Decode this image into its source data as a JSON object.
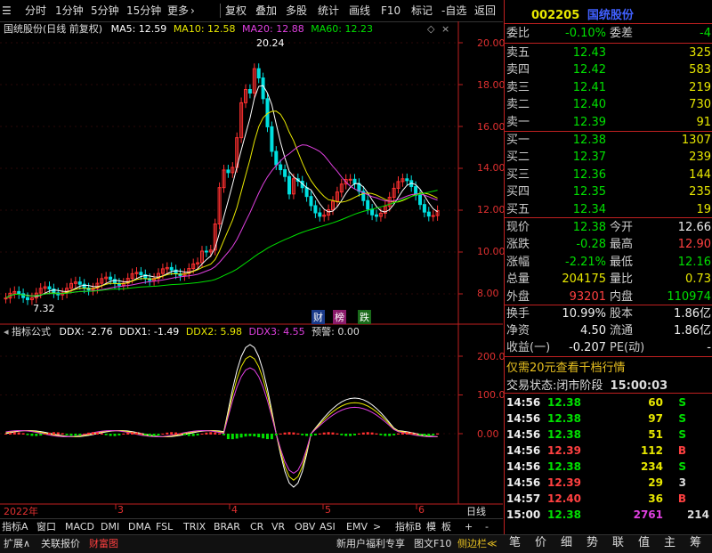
{
  "toolbar": {
    "items": [
      "分时",
      "1分钟",
      "5分钟",
      "15分钟",
      "更多",
      "复权",
      "叠加",
      "多股",
      "统计",
      "画线",
      "F10",
      "标记",
      "-自选",
      "返回"
    ]
  },
  "chart": {
    "stock_title": "国统股份(日线 前复权)",
    "ma5": "MA5: 12.59",
    "ma10": "MA10: 12.58",
    "ma20": "MA20: 12.88",
    "ma60": "MA60: 12.23",
    "high_label": "20.24",
    "low_label": "7.32",
    "y_labels": [
      "20.00",
      "18.00",
      "16.00",
      "14.00",
      "12.00",
      "10.00",
      "8.00"
    ],
    "tags": [
      "财",
      "榜",
      "跌"
    ],
    "colors": {
      "up": "#ff3030",
      "down": "#00e0e0",
      "ma5": "#ffffff",
      "ma10": "#e8e800",
      "ma20": "#e040e0",
      "ma60": "#00e000"
    }
  },
  "indicator": {
    "name": "指标公式",
    "ddx": "DDX: -2.76",
    "ddx1": "DDX1: -1.49",
    "ddx2": "DDX2: 5.98",
    "ddx3": "DDX3: 4.55",
    "alert": "预警: 0.00",
    "y_labels": [
      "200.0",
      "100.0",
      "0.00"
    ]
  },
  "xaxis": {
    "labels": [
      "2022年",
      "3",
      "4",
      "5",
      "6"
    ],
    "right_label": "日线"
  },
  "bottom_tabs": [
    "指标A",
    "窗口",
    "MACD",
    "DMI",
    "DMA",
    "FSL",
    "TRIX",
    "BRAR",
    "CR",
    "VR",
    "OBV",
    "ASI",
    "EMV",
    ">",
    "指标B",
    "模",
    "板",
    "+",
    "-"
  ],
  "status_left": [
    "扩展∧",
    "关联报价",
    "财富图"
  ],
  "status_mid": [
    "新用户福利专享",
    "图文F10",
    "侧边栏≪"
  ],
  "status_right": [
    "笔",
    "价",
    "细",
    "势",
    "联",
    "值",
    "主",
    "筹"
  ],
  "quote": {
    "code": "002205",
    "name": "国统股份",
    "weibi_label": "委比",
    "weibi": "-0.10%",
    "weicha_label": "委差",
    "weicha": "-4",
    "sells": [
      {
        "label": "卖五",
        "price": "12.43",
        "vol": "325"
      },
      {
        "label": "卖四",
        "price": "12.42",
        "vol": "583"
      },
      {
        "label": "卖三",
        "price": "12.41",
        "vol": "219"
      },
      {
        "label": "卖二",
        "price": "12.40",
        "vol": "730"
      },
      {
        "label": "卖一",
        "price": "12.39",
        "vol": "91"
      }
    ],
    "buys": [
      {
        "label": "买一",
        "price": "12.38",
        "vol": "1307"
      },
      {
        "label": "买二",
        "price": "12.37",
        "vol": "239"
      },
      {
        "label": "买三",
        "price": "12.36",
        "vol": "144"
      },
      {
        "label": "买四",
        "price": "12.35",
        "vol": "235"
      },
      {
        "label": "买五",
        "price": "12.34",
        "vol": "19"
      }
    ],
    "stats": [
      {
        "l1": "现价",
        "v1": "12.38",
        "c1": "green",
        "l2": "今开",
        "v2": "12.66",
        "c2": "white"
      },
      {
        "l1": "涨跌",
        "v1": "-0.28",
        "c1": "green",
        "l2": "最高",
        "v2": "12.90",
        "c2": "red"
      },
      {
        "l1": "涨幅",
        "v1": "-2.21%",
        "c1": "green",
        "l2": "最低",
        "v2": "12.16",
        "c2": "green"
      },
      {
        "l1": "总量",
        "v1": "204175",
        "c1": "yellow",
        "l2": "量比",
        "v2": "0.73",
        "c2": "yellow"
      },
      {
        "l1": "外盘",
        "v1": "93201",
        "c1": "red",
        "l2": "内盘",
        "v2": "110974",
        "c2": "green"
      }
    ],
    "stats2": [
      {
        "l1": "换手",
        "v1": "10.99%",
        "l2": "股本",
        "v2": "1.86亿"
      },
      {
        "l1": "净资",
        "v1": "4.50",
        "l2": "流通",
        "v2": "1.86亿"
      },
      {
        "l1": "收益(一)",
        "v1": "-0.207",
        "l2": "PE(动)",
        "v2": "-"
      }
    ],
    "promo": "仅需20元查看千档行情",
    "trade_status_label": "交易状态:",
    "trade_status": "闭市阶段",
    "trade_time": "15:00:03",
    "ticks": [
      {
        "t": "14:56",
        "p": "12.38",
        "v": "60",
        "s": "S"
      },
      {
        "t": "14:56",
        "p": "12.38",
        "v": "97",
        "s": "S"
      },
      {
        "t": "14:56",
        "p": "12.38",
        "v": "51",
        "s": "S"
      },
      {
        "t": "14:56",
        "p": "12.39",
        "v": "112",
        "s": "B"
      },
      {
        "t": "14:56",
        "p": "12.38",
        "v": "234",
        "s": "S"
      },
      {
        "t": "14:56",
        "p": "12.39",
        "v": "29",
        "s": "3"
      },
      {
        "t": "14:57",
        "p": "12.40",
        "v": "36",
        "s": "B"
      },
      {
        "t": "15:00",
        "p": "12.38",
        "v": "2761",
        "s": "214"
      }
    ]
  }
}
